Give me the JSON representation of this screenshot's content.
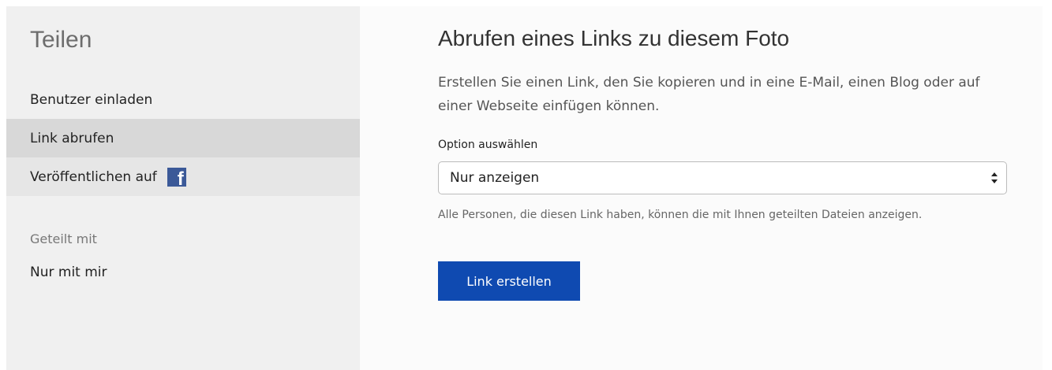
{
  "sidebar": {
    "title": "Teilen",
    "items": [
      {
        "label": "Benutzer einladen"
      },
      {
        "label": "Link abrufen"
      },
      {
        "label": "Veröffentlichen auf"
      }
    ],
    "shared_with_label": "Geteilt mit",
    "shared_with_value": "Nur mit mir"
  },
  "main": {
    "title": "Abrufen eines Links zu diesem Foto",
    "description": "Erstellen Sie einen Link, den Sie kopieren und in eine E-Mail, einen Blog oder auf einer Webseite einfügen können.",
    "option_label": "Option auswählen",
    "select_value": "Nur anzeigen",
    "help_text": "Alle Personen, die diesen Link haben, können die mit Ihnen geteilten Dateien anzeigen.",
    "button_label": "Link erstellen"
  },
  "icons": {
    "facebook": "facebook-icon",
    "select_arrows": "updown-arrows-icon"
  },
  "colors": {
    "button": "#0f4ab1",
    "facebook": "#3b5998",
    "selected_item": "#d8d8d8"
  }
}
